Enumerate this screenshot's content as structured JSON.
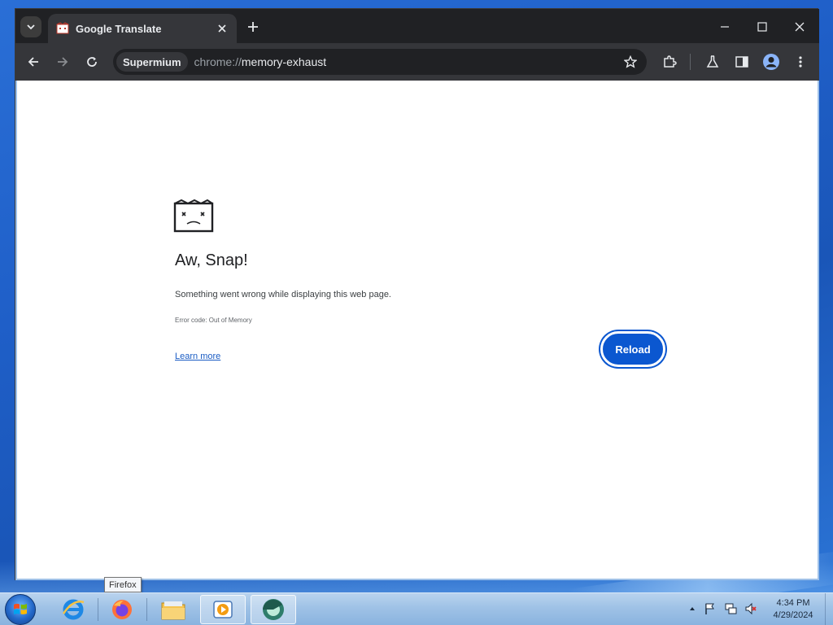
{
  "browser": {
    "tab": {
      "title": "Google Translate"
    },
    "omnibox": {
      "chip": "Supermium",
      "url_scheme": "chrome://",
      "url_host": "memory-exhaust"
    }
  },
  "page": {
    "heading": "Aw, Snap!",
    "message": "Something went wrong while displaying this web page.",
    "error_code": "Error code: Out of Memory",
    "learn_more": "Learn more",
    "reload": "Reload"
  },
  "taskbar": {
    "items": [
      "start-orb",
      "internet-explorer-icon",
      "firefox-icon",
      "file-explorer-icon",
      "media-player-icon",
      "browser-icon"
    ],
    "tooltip": "Firefox",
    "clock": {
      "time": "4:34 PM",
      "date": "4/29/2024"
    }
  },
  "colors": {
    "accent": "#0b57d0",
    "browser_frame": "#202124",
    "toolbar": "#35363a",
    "link": "#1a5cc4"
  }
}
